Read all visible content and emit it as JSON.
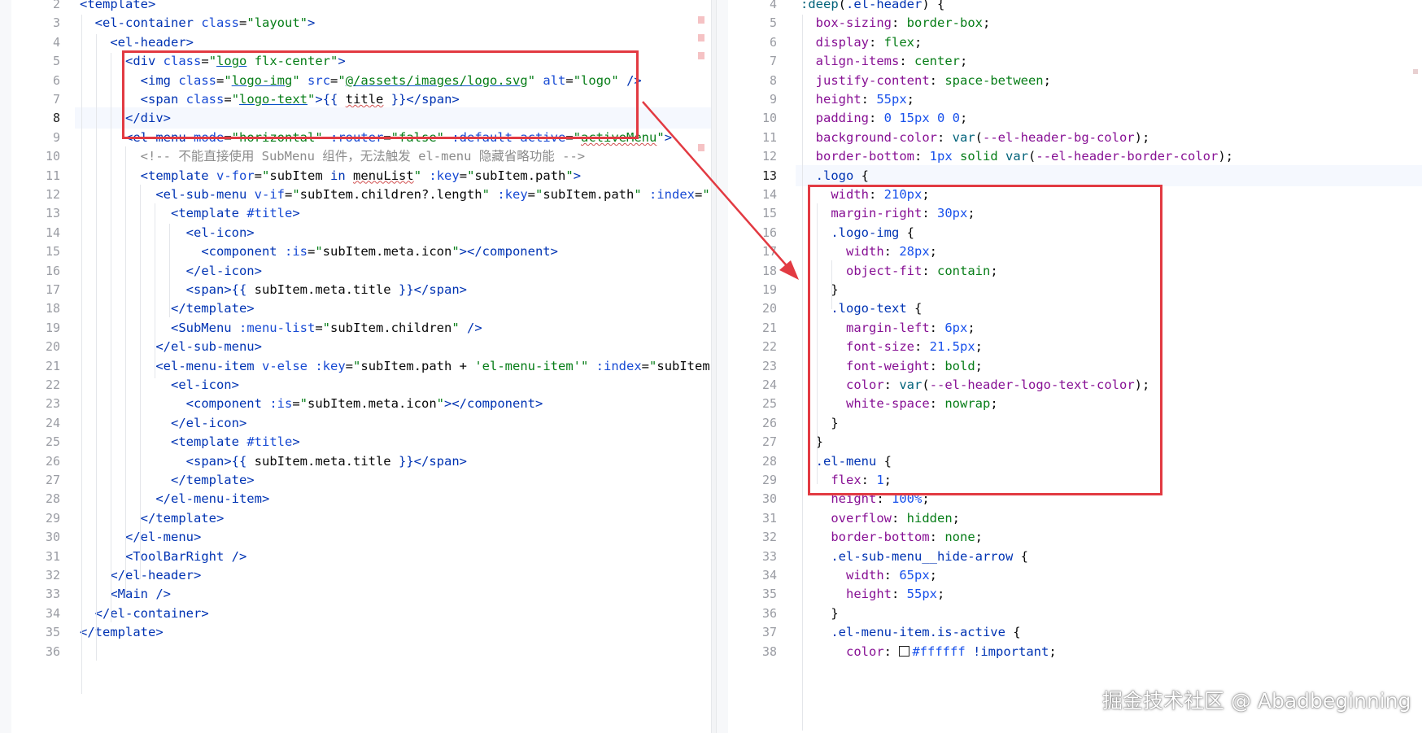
{
  "left_editor": {
    "active_line": "8",
    "lines": [
      {
        "n": "2",
        "html": "<span class='t-tag'>&lt;template&gt;</span>"
      },
      {
        "n": "3",
        "html": "  <span class='t-tag'>&lt;el-container</span> <span class='t-attr'>class</span>=<span class='t-str'>\"layout\"</span><span class='t-tag'>&gt;</span>"
      },
      {
        "n": "4",
        "html": "    <span class='t-tag'>&lt;el-header&gt;</span>"
      },
      {
        "n": "5",
        "html": "      <span class='t-tag'>&lt;div</span> <span class='t-attr'>class</span>=<span class='t-str'>\"<span class='t-u'>logo</span> flx-center\"</span><span class='t-tag'>&gt;</span>"
      },
      {
        "n": "6",
        "html": "        <span class='t-tag'>&lt;img</span> <span class='t-attr'>class</span>=<span class='t-str'>\"<span class='t-u'>logo-img</span>\"</span> <span class='t-attr'>src</span>=<span class='t-str'>\"<span class='t-u'>@/assets/images/logo.svg</span>\"</span> <span class='t-attr'>alt</span>=<span class='t-str'>\"logo\"</span> <span class='t-tag'>/&gt;</span>"
      },
      {
        "n": "7",
        "html": "        <span class='t-tag'>&lt;span</span> <span class='t-attr'>class</span>=<span class='t-str'>\"<span class='t-u'>logo-text</span>\"</span><span class='t-tag'>&gt;</span><span class='t-kw'>{{</span> <span class='t-plain t-wavy'>title</span> <span class='t-kw'>}}</span><span class='t-tag'>&lt;/span&gt;</span>"
      },
      {
        "n": "8",
        "html": "      <span class='t-tag'>&lt;/div&gt;</span>",
        "hl": true
      },
      {
        "n": "9",
        "html": "      <span class='t-tag'>&lt;el-menu</span> <span class='t-attr'>mode</span>=<span class='t-str'>\"horizontal\"</span> <span class='t-attr'>:router</span>=<span class='t-str'>\"false\"</span> <span class='t-attr'>:default-active</span>=<span class='t-str'>\"<span class='t-wavy'>activeMenu</span>\"</span><span class='t-tag'>&gt;</span>"
      },
      {
        "n": "10",
        "html": "        <span class='t-com'>&lt;!-- 不能直接使用 SubMenu 组件，无法触发 el-menu 隐藏省略功能 --&gt;</span>"
      },
      {
        "n": "11",
        "html": "        <span class='t-tag'>&lt;template</span> <span class='t-attr'>v-for</span>=<span class='t-str'>\"</span><span class='t-plain'>subItem</span> <span class='t-kw'>in</span> <span class='t-plain t-wavy'>menuList</span><span class='t-str'>\"</span> <span class='t-attr'>:key</span>=<span class='t-str'>\"</span><span class='t-plain'>subItem.path</span><span class='t-str'>\"</span><span class='t-tag'>&gt;</span>"
      },
      {
        "n": "12",
        "html": "          <span class='t-tag'>&lt;el-sub-menu</span> <span class='t-attr'>v-if</span>=<span class='t-str'>\"</span><span class='t-plain'>subItem.children?.length</span><span class='t-str'>\"</span> <span class='t-attr'>:key</span>=<span class='t-str'>\"</span><span class='t-plain'>subItem.path</span><span class='t-str'>\"</span> <span class='t-attr'>:index</span>=<span class='t-str'>\"</span><span class='t-plain'>sub</span>"
      },
      {
        "n": "13",
        "html": "            <span class='t-tag'>&lt;template</span> <span class='t-attr'>#title</span><span class='t-tag'>&gt;</span>"
      },
      {
        "n": "14",
        "html": "              <span class='t-tag'>&lt;el-icon&gt;</span>"
      },
      {
        "n": "15",
        "html": "                <span class='t-tag'>&lt;component</span> <span class='t-attr'>:is</span>=<span class='t-str'>\"</span><span class='t-plain'>subItem.meta.icon</span><span class='t-str'>\"</span><span class='t-tag'>&gt;&lt;/component&gt;</span>"
      },
      {
        "n": "16",
        "html": "              <span class='t-tag'>&lt;/el-icon&gt;</span>"
      },
      {
        "n": "17",
        "html": "              <span class='t-tag'>&lt;span&gt;</span><span class='t-kw'>{{</span> <span class='t-plain'>subItem.meta.title</span> <span class='t-kw'>}}</span><span class='t-tag'>&lt;/span&gt;</span>"
      },
      {
        "n": "18",
        "html": "            <span class='t-tag'>&lt;/template&gt;</span>"
      },
      {
        "n": "19",
        "html": "            <span class='t-tag'>&lt;SubMenu</span> <span class='t-attr'>:menu-list</span>=<span class='t-str'>\"</span><span class='t-plain'>subItem.children</span><span class='t-str'>\"</span> <span class='t-tag'>/&gt;</span>"
      },
      {
        "n": "20",
        "html": "          <span class='t-tag'>&lt;/el-sub-menu&gt;</span>"
      },
      {
        "n": "21",
        "html": "          <span class='t-tag'>&lt;el-menu-item</span> <span class='t-attr'>v-else</span> <span class='t-attr'>:key</span>=<span class='t-str'>\"</span><span class='t-plain'>subItem.path + </span><span class='t-str'>'el-menu-item'\"</span> <span class='t-attr'>:index</span>=<span class='t-str'>\"</span><span class='t-plain'>subItem.pa</span>"
      },
      {
        "n": "22",
        "html": "            <span class='t-tag'>&lt;el-icon&gt;</span>"
      },
      {
        "n": "23",
        "html": "              <span class='t-tag'>&lt;component</span> <span class='t-attr'>:is</span>=<span class='t-str'>\"</span><span class='t-plain'>subItem.meta.icon</span><span class='t-str'>\"</span><span class='t-tag'>&gt;&lt;/component&gt;</span>"
      },
      {
        "n": "24",
        "html": "            <span class='t-tag'>&lt;/el-icon&gt;</span>"
      },
      {
        "n": "25",
        "html": "            <span class='t-tag'>&lt;template</span> <span class='t-attr'>#title</span><span class='t-tag'>&gt;</span>"
      },
      {
        "n": "26",
        "html": "              <span class='t-tag'>&lt;span&gt;</span><span class='t-kw'>{{</span> <span class='t-plain'>subItem.meta.title</span> <span class='t-kw'>}}</span><span class='t-tag'>&lt;/span&gt;</span>"
      },
      {
        "n": "27",
        "html": "            <span class='t-tag'>&lt;/template&gt;</span>"
      },
      {
        "n": "28",
        "html": "          <span class='t-tag'>&lt;/el-menu-item&gt;</span>"
      },
      {
        "n": "29",
        "html": "        <span class='t-tag'>&lt;/template&gt;</span>"
      },
      {
        "n": "30",
        "html": "      <span class='t-tag'>&lt;/el-menu&gt;</span>"
      },
      {
        "n": "31",
        "html": "      <span class='t-tag'>&lt;ToolBarRight /&gt;</span>"
      },
      {
        "n": "32",
        "html": "    <span class='t-tag'>&lt;/el-header&gt;</span>"
      },
      {
        "n": "33",
        "html": "    <span class='t-tag'>&lt;Main /&gt;</span>"
      },
      {
        "n": "34",
        "html": "  <span class='t-tag'>&lt;/el-container&gt;</span>"
      },
      {
        "n": "35",
        "html": "<span class='t-tag'>&lt;/template&gt;</span>"
      },
      {
        "n": "36",
        "html": ""
      }
    ]
  },
  "right_editor": {
    "active_line": "13",
    "lines": [
      {
        "n": "4",
        "html": "<span class='t-fn'>:deep</span>(<span class='t-sel'>.el-header</span>) {"
      },
      {
        "n": "5",
        "html": "  <span class='t-prop'>box-sizing</span>: <span class='t-val'>border-box</span>;"
      },
      {
        "n": "6",
        "html": "  <span class='t-prop'>display</span>: <span class='t-val'>flex</span>;"
      },
      {
        "n": "7",
        "html": "  <span class='t-prop'>align-items</span>: <span class='t-val'>center</span>;"
      },
      {
        "n": "8",
        "html": "  <span class='t-prop'>justify-content</span>: <span class='t-val'>space-between</span>;"
      },
      {
        "n": "9",
        "html": "  <span class='t-prop'>height</span>: <span class='t-num'>55px</span>;"
      },
      {
        "n": "10",
        "html": "  <span class='t-prop'>padding</span>: <span class='t-num'>0 15px 0 0</span>;"
      },
      {
        "n": "11",
        "html": "  <span class='t-prop'>background-color</span>: <span class='t-fn'>var</span>(<span class='t-prop'>--el-header-bg-color</span>);"
      },
      {
        "n": "12",
        "html": "  <span class='t-prop'>border-bottom</span>: <span class='t-num'>1px</span> <span class='t-val'>solid</span> <span class='t-fn'>var</span>(<span class='t-prop'>--el-header-border-color</span>);"
      },
      {
        "n": "13",
        "html": "  <span class='t-sel'>.logo</span> {",
        "hl": true
      },
      {
        "n": "14",
        "html": "    <span class='t-prop'>width</span>: <span class='t-num'>210px</span>;"
      },
      {
        "n": "15",
        "html": "    <span class='t-prop'>margin-right</span>: <span class='t-num'>30px</span>;"
      },
      {
        "n": "16",
        "html": "    <span class='t-sel'>.logo-img</span> {"
      },
      {
        "n": "17",
        "html": "      <span class='t-prop'>width</span>: <span class='t-num'>28px</span>;"
      },
      {
        "n": "18",
        "html": "      <span class='t-prop'>object-fit</span>: <span class='t-val'>contain</span>;"
      },
      {
        "n": "19",
        "html": "    }"
      },
      {
        "n": "20",
        "html": "    <span class='t-sel'>.logo-text</span> {"
      },
      {
        "n": "21",
        "html": "      <span class='t-prop'>margin-left</span>: <span class='t-num'>6px</span>;"
      },
      {
        "n": "22",
        "html": "      <span class='t-prop'>font-size</span>: <span class='t-num'>21.5px</span>;"
      },
      {
        "n": "23",
        "html": "      <span class='t-prop'>font-weight</span>: <span class='t-val'>bold</span>;"
      },
      {
        "n": "24",
        "html": "      <span class='t-prop'>color</span>: <span class='t-fn'>var</span>(<span class='t-prop'>--el-header-logo-text-color</span>);"
      },
      {
        "n": "25",
        "html": "      <span class='t-prop'>white-space</span>: <span class='t-val'>nowrap</span>;"
      },
      {
        "n": "26",
        "html": "    }"
      },
      {
        "n": "27",
        "html": "  }"
      },
      {
        "n": "28",
        "html": "  <span class='t-sel'>.el-menu</span> {"
      },
      {
        "n": "29",
        "html": "    <span class='t-prop'>flex</span>: <span class='t-num'>1</span>;"
      },
      {
        "n": "30",
        "html": "    <span class='t-prop'>height</span>: <span class='t-num'>100%</span>;"
      },
      {
        "n": "31",
        "html": "    <span class='t-prop'>overflow</span>: <span class='t-val'>hidden</span>;"
      },
      {
        "n": "32",
        "html": "    <span class='t-prop'>border-bottom</span>: <span class='t-val'>none</span>;"
      },
      {
        "n": "33",
        "html": "    <span class='t-sel'>.el-sub-menu__hide-arrow</span> {"
      },
      {
        "n": "34",
        "html": "      <span class='t-prop'>width</span>: <span class='t-num'>65px</span>;"
      },
      {
        "n": "35",
        "html": "      <span class='t-prop'>height</span>: <span class='t-num'>55px</span>;"
      },
      {
        "n": "36",
        "html": "    }"
      },
      {
        "n": "37",
        "html": "    <span class='t-sel'>.el-menu-item.is-active</span> {"
      },
      {
        "n": "38",
        "html": "      <span class='t-prop'>color</span>: <span style='display:inline-block;width:11px;height:11px;border:1px solid #222;background:#fff;vertical-align:-1px;margin-right:3px'></span><span class='t-num'>#ffffff</span> <span class='t-kw'>!important</span>;"
      }
    ]
  },
  "watermark": "掘金技术社区 @ Abadbeginning",
  "colors": {
    "highlight_box": "#e23a42",
    "active_line_bg": "#f5f8fe"
  }
}
